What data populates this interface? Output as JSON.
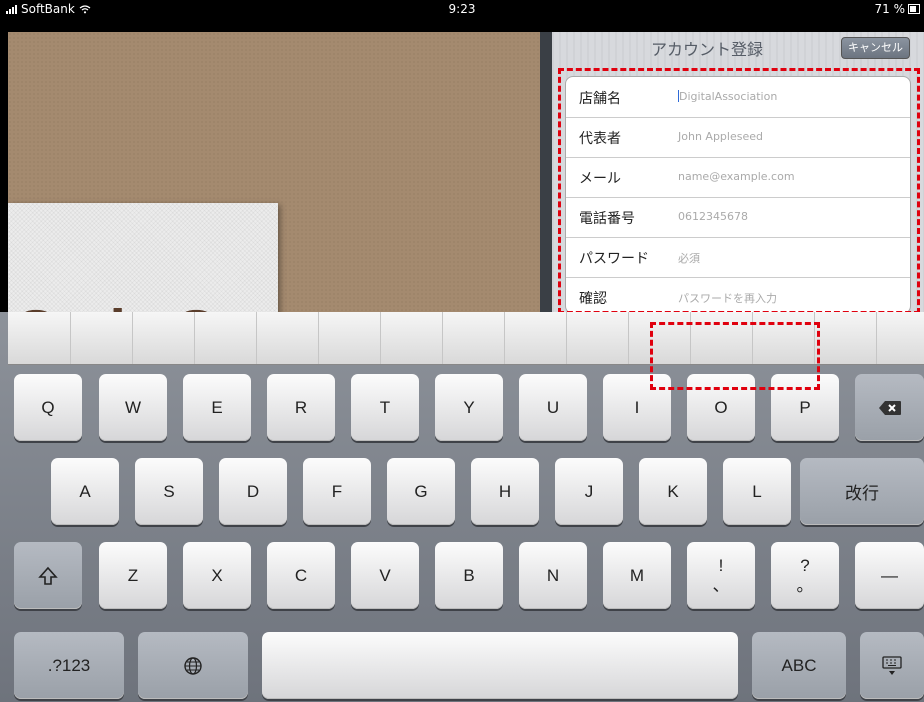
{
  "status_bar": {
    "carrier": "SoftBank",
    "time": "9:23",
    "battery": "71 %"
  },
  "background": {
    "card_text": "Style S"
  },
  "account_panel": {
    "title": "アカウント登録",
    "cancel_label": "キャンセル",
    "fields": [
      {
        "label": "店舗名",
        "placeholder": "DigitalAssociation"
      },
      {
        "label": "代表者",
        "placeholder": "John Appleseed"
      },
      {
        "label": "メール",
        "placeholder": "name@example.com"
      },
      {
        "label": "電話番号",
        "placeholder": "0612345678"
      },
      {
        "label": "パスワード",
        "placeholder": "必須"
      },
      {
        "label": "確認",
        "placeholder": "パスワードを再入力"
      }
    ]
  },
  "keyboard": {
    "row1": [
      "Q",
      "W",
      "E",
      "R",
      "T",
      "Y",
      "U",
      "I",
      "O",
      "P"
    ],
    "delete_icon": "backspace-icon",
    "row2": [
      "A",
      "S",
      "D",
      "F",
      "G",
      "H",
      "J",
      "K",
      "L"
    ],
    "return_label": "改行",
    "shift_icon": "shift-icon",
    "row3": [
      "Z",
      "X",
      "C",
      "V",
      "B",
      "N",
      "M"
    ],
    "exclaim_label": "!",
    "exclaim_sub": "、",
    "question_label": "?",
    "question_sub": "。",
    "dash_label": "—",
    "numbers_label": ".?123",
    "globe_icon": "globe-icon",
    "abc_label": "ABC",
    "hide_icon": "keyboard-hide-icon"
  }
}
